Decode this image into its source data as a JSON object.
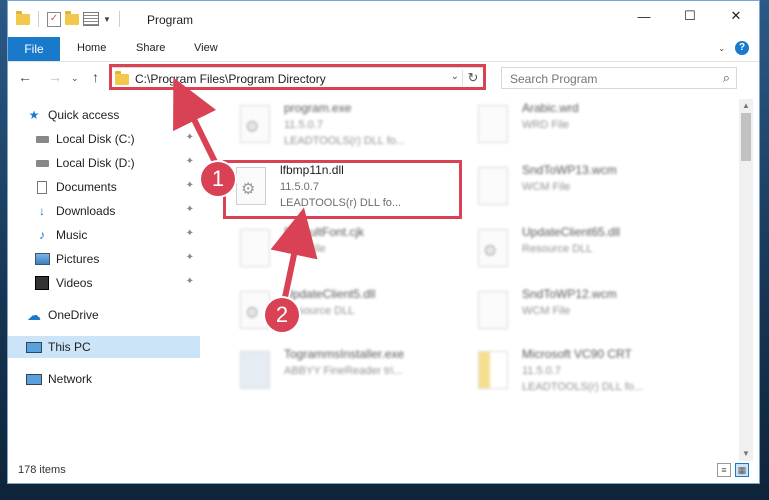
{
  "window": {
    "title": "Program"
  },
  "ribbon": {
    "file": "File",
    "tabs": [
      "Home",
      "Share",
      "View"
    ],
    "help": "?"
  },
  "address": {
    "path": "C:\\Program Files\\Program Directory"
  },
  "search": {
    "placeholder": "Search Program"
  },
  "sidebar": {
    "items": [
      {
        "label": "Quick access",
        "icon": "star-icon"
      },
      {
        "label": "Local Disk (C:)",
        "icon": "drive-icon",
        "pinned": true
      },
      {
        "label": "Local Disk (D:)",
        "icon": "drive-icon",
        "pinned": true
      },
      {
        "label": "Documents",
        "icon": "documents-icon",
        "pinned": true
      },
      {
        "label": "Downloads",
        "icon": "download-icon",
        "pinned": true
      },
      {
        "label": "Music",
        "icon": "music-icon",
        "pinned": true
      },
      {
        "label": "Pictures",
        "icon": "pictures-icon",
        "pinned": true
      },
      {
        "label": "Videos",
        "icon": "videos-icon",
        "pinned": true
      },
      {
        "label": "OneDrive",
        "icon": "cloud-icon"
      },
      {
        "label": "This PC",
        "icon": "computer-icon",
        "selected": true
      },
      {
        "label": "Network",
        "icon": "network-icon"
      }
    ]
  },
  "files": [
    {
      "name": "program.exe",
      "line1": "11.5.0.7",
      "line2": "LEADTOOLS(r) DLL fo..."
    },
    {
      "name": "Arabic.wrd",
      "line1": "WRD File",
      "line2": ""
    },
    {
      "name": "lfbmp11n.dll",
      "line1": "11.5.0.7",
      "line2": "LEADTOOLS(r) DLL fo..."
    },
    {
      "name": "SndToWP13.wcm",
      "line1": "WCM File",
      "line2": ""
    },
    {
      "name": "DefaultFont.cjk",
      "line1": "CJK File",
      "line2": ""
    },
    {
      "name": "UpdateClient65.dll",
      "line1": "Resource DLL",
      "line2": ""
    },
    {
      "name": "UpdateClient5.dll",
      "line1": "Resource DLL",
      "line2": ""
    },
    {
      "name": "SndToWP12.wcm",
      "line1": "WCM File",
      "line2": ""
    },
    {
      "name": "TogrammsInstaller.exe",
      "line1": "ABBYY FineReader tri...",
      "line2": ""
    },
    {
      "name": "Microsoft VC90 CRT",
      "line1": "11.5.0.7",
      "line2": "LEADTOOLS(r) DLL fo..."
    }
  ],
  "status": {
    "count": "178 items"
  },
  "annotations": {
    "step1": "1",
    "step2": "2"
  },
  "colors": {
    "accent": "#1979ca",
    "highlight": "#d94155"
  }
}
